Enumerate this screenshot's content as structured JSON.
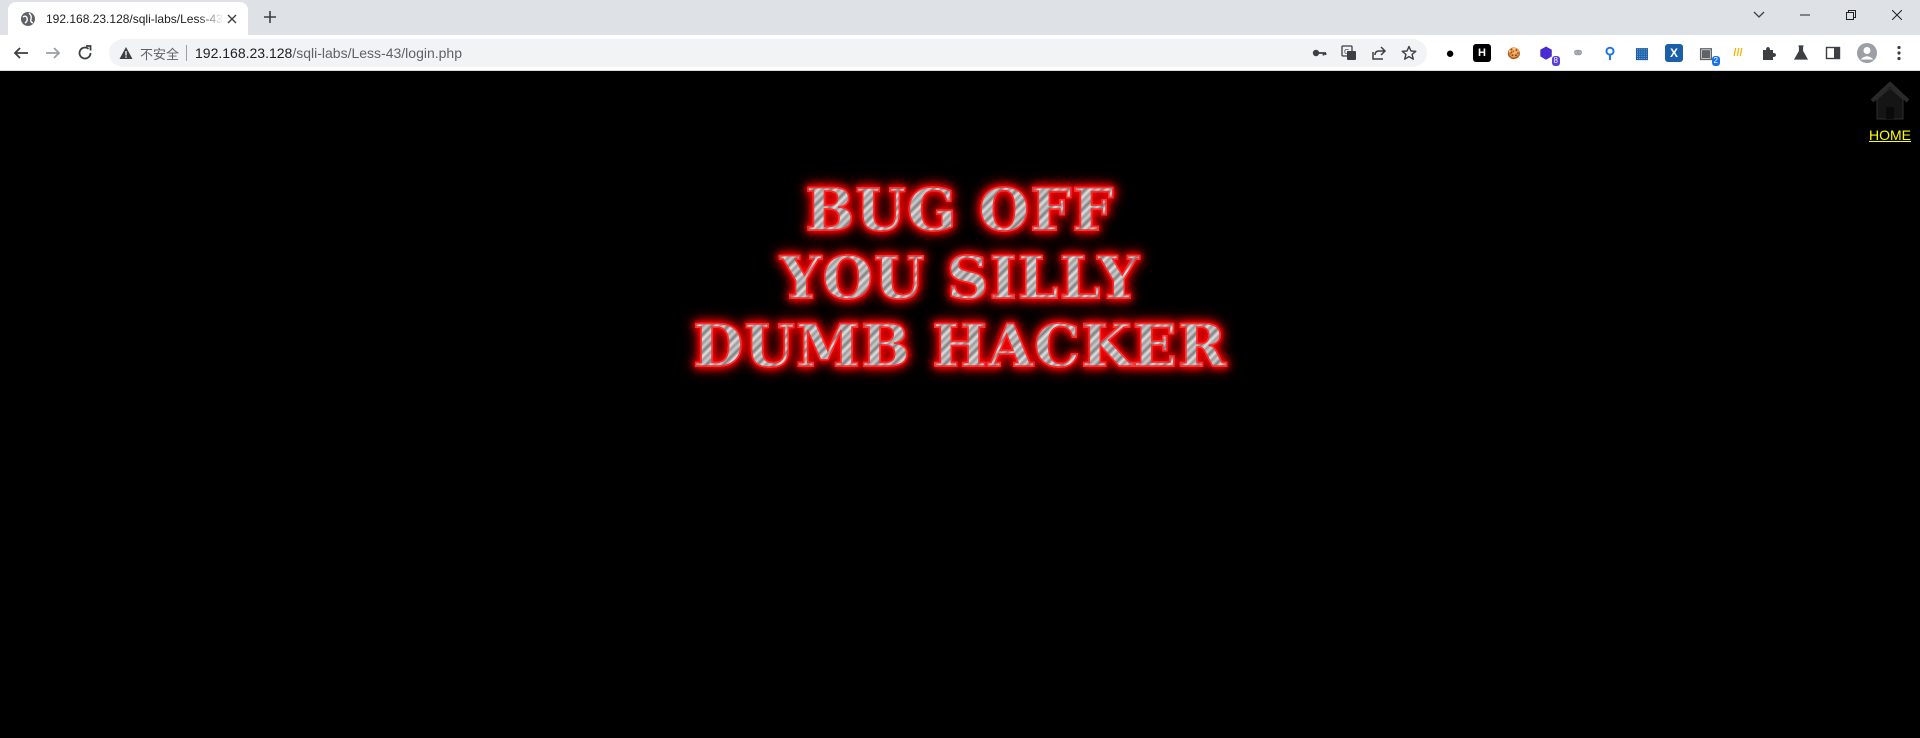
{
  "browser": {
    "tab_title": "192.168.23.128/sqli-labs/Less-43/login.php",
    "security_label": "不安全",
    "url_host": "192.168.23.128",
    "url_path": "/sqli-labs/Less-43/login.php",
    "extensions": [
      {
        "name": "circle-extension-icon",
        "glyph": "●",
        "color": "#000000"
      },
      {
        "name": "h-extension-icon",
        "glyph": "H",
        "color": "#000000"
      },
      {
        "name": "cookie-extension-icon",
        "glyph": "🍪",
        "color": "#c98b2a"
      },
      {
        "name": "hexagon-extension-icon",
        "glyph": "⬢",
        "color": "#4a2bd1",
        "badge": "8",
        "badge_color": "#5b3fd6"
      },
      {
        "name": "links-extension-icon",
        "glyph": "⚭",
        "color": "#9aa0a6"
      },
      {
        "name": "pin-extension-icon",
        "glyph": "⚲",
        "color": "#1a73e8"
      },
      {
        "name": "chart-extension-icon",
        "glyph": "▦",
        "color": "#1a5fa8"
      },
      {
        "name": "x-extension-icon",
        "glyph": "X",
        "color": "#ffffff"
      },
      {
        "name": "screen-extension-icon",
        "glyph": "▣",
        "color": "#5f6368",
        "badge": "2",
        "badge_color": "#1a73e8"
      },
      {
        "name": "stripes-extension-icon",
        "glyph": "///",
        "color": "#f4b400"
      }
    ]
  },
  "page": {
    "home_label": "HOME",
    "taunt_lines": [
      "BUG OFF",
      "YOU SILLY",
      "DUMB HACKER"
    ],
    "colors": {
      "background": "#000000",
      "home_link": "#ffff00",
      "glow": "#ff0000"
    }
  }
}
